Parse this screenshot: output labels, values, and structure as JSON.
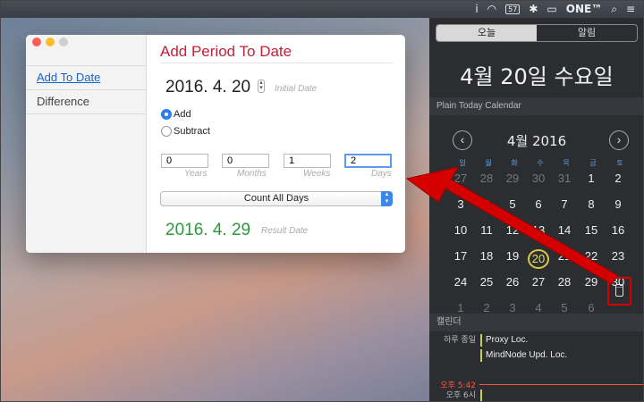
{
  "menubar": {
    "items": [
      "i",
      "☰",
      "57",
      "✱",
      "🇺🇸",
      "ONE™",
      "⌕",
      "≡"
    ]
  },
  "window": {
    "sidebar": {
      "items": [
        {
          "label": "Add To Date",
          "active": true
        },
        {
          "label": "Difference",
          "active": false
        }
      ]
    },
    "title": "Add Period To Date",
    "initial_date": "2016.  4. 20",
    "initial_date_label": "Initial Date",
    "radio_add": "Add",
    "radio_subtract": "Subtract",
    "fields": {
      "years": {
        "value": "0",
        "label": "Years"
      },
      "months": {
        "value": "0",
        "label": "Months"
      },
      "weeks": {
        "value": "1",
        "label": "Weeks"
      },
      "days": {
        "value": "2",
        "label": "Days"
      }
    },
    "count_mode": "Count All Days",
    "result_date": "2016.  4. 29",
    "result_label": "Result Date"
  },
  "notification_center": {
    "tabs": [
      "오늘",
      "알림"
    ],
    "today_date": "4월 20일 수요일",
    "widget_title": "Plain Today Calendar",
    "calendar": {
      "month_title": "4월 2016",
      "weekdays": [
        "일",
        "월",
        "화",
        "수",
        "목",
        "금",
        "토"
      ],
      "weeks": [
        [
          "27",
          "28",
          "29",
          "30",
          "31",
          "1",
          "2"
        ],
        [
          "3",
          "4",
          "5",
          "6",
          "7",
          "8",
          "9"
        ],
        [
          "10",
          "11",
          "12",
          "13",
          "14",
          "15",
          "16"
        ],
        [
          "17",
          "18",
          "19",
          "20",
          "21",
          "22",
          "23"
        ],
        [
          "24",
          "25",
          "26",
          "27",
          "28",
          "29",
          "30"
        ],
        [
          "1",
          "2",
          "3",
          "4",
          "5",
          "6",
          ""
        ]
      ],
      "today": "20"
    },
    "calendar_section": "캘린더",
    "events": [
      {
        "time": "하루 종일",
        "title": "Proxy Loc."
      },
      {
        "time": "",
        "title": "MindNode Upd. Loc."
      }
    ],
    "now_time": "오후 5:42",
    "next_time": "오후 6시"
  },
  "colors": {
    "accent_red": "#c4213b",
    "result_green": "#2a9a38",
    "annotation_red": "#d40000",
    "today_ring": "#d9c84a"
  }
}
